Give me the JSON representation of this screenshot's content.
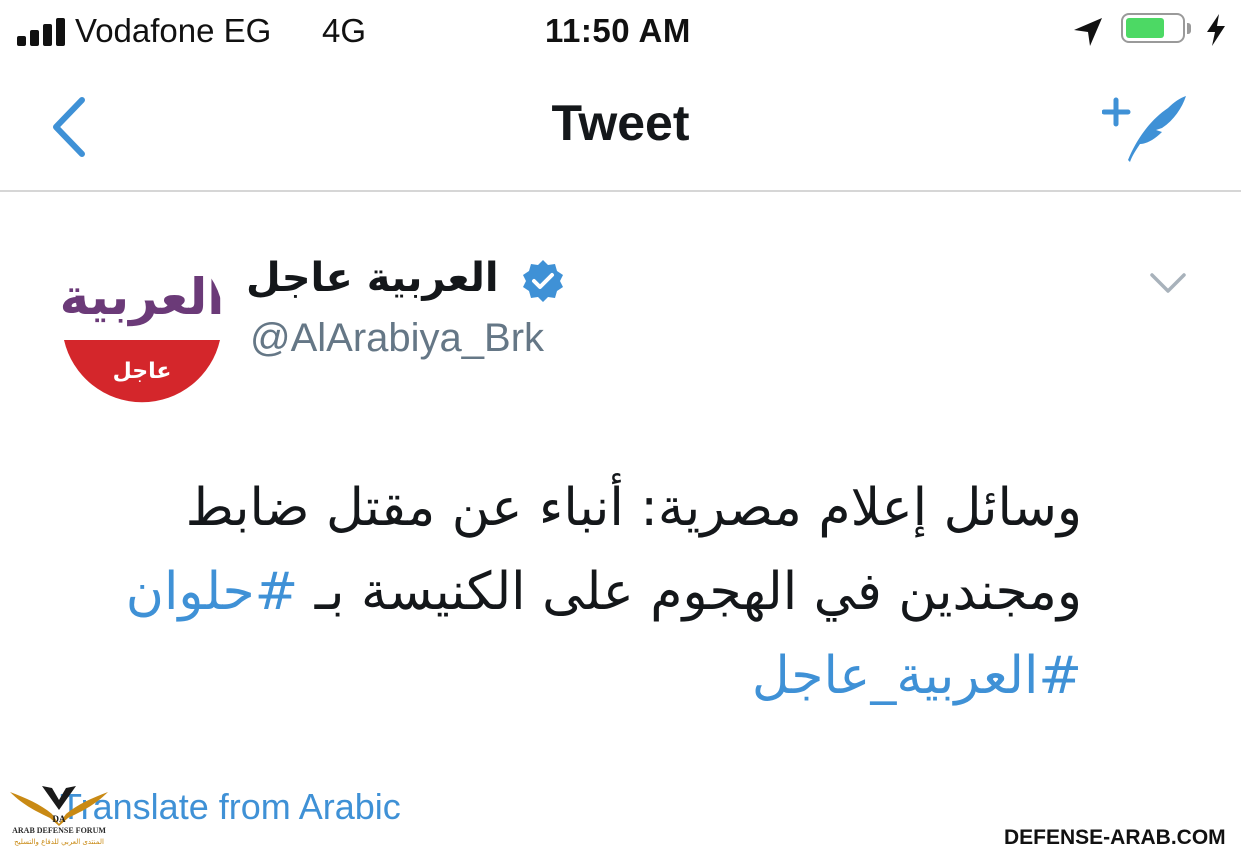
{
  "status_bar": {
    "carrier": "Vodafone EG",
    "network": "4G",
    "time": "11:50 AM",
    "battery_level": 0.7,
    "signal_bars": 4
  },
  "nav_bar": {
    "title": "Tweet",
    "back_icon": "chevron-left-icon",
    "compose_icon": "compose-tweet-icon"
  },
  "tweet": {
    "author_name": "العربية عاجل",
    "handle": "@AlArabiya_Brk",
    "verified": true,
    "text_line1": "وسائل إعلام مصرية: أنباء عن مقتل ضابط",
    "text_line2": "ومجندين في الهجوم على الكنيسة بـ ",
    "hashtag1": "#حلوان",
    "hashtag2": "#العربية_عاجل",
    "translate_label": "Translate from Arabic",
    "avatar": {
      "logo_text": "العربية",
      "badge_text": "عاجل"
    }
  },
  "watermarks": {
    "forum_title": "ARAB DEFENSE FORUM",
    "forum_subtitle": "المنتدى العربي للدفاع والتسليح",
    "forum_mark": "DA",
    "site": "DEFENSE-ARAB.COM"
  },
  "colors": {
    "accent": "#3f91d6",
    "handle": "#657786",
    "avatar_purple": "#6b3a78",
    "avatar_red": "#d4262b",
    "battery_green": "#4cd964"
  }
}
